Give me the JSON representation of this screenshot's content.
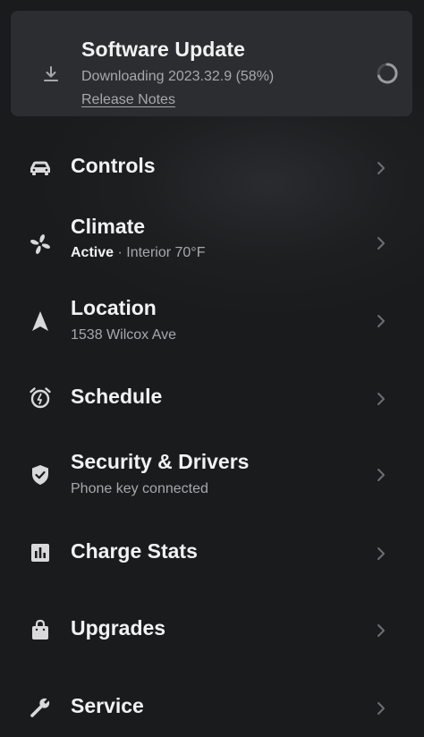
{
  "update": {
    "title": "Software Update",
    "status": "Downloading 2023.32.9 (58%)",
    "release_notes": "Release Notes",
    "progress_percent": 58,
    "icon": "download-icon"
  },
  "menu": [
    {
      "key": "controls",
      "title": "Controls",
      "subtitle": "",
      "icon": "car-icon"
    },
    {
      "key": "climate",
      "title": "Climate",
      "subtitle_strong": "Active",
      "subtitle": " · Interior 70°F",
      "icon": "fan-icon"
    },
    {
      "key": "location",
      "title": "Location",
      "subtitle": "1538 Wilcox Ave",
      "icon": "navigation-arrow-icon"
    },
    {
      "key": "schedule",
      "title": "Schedule",
      "subtitle": "",
      "icon": "alarm-clock-icon"
    },
    {
      "key": "security",
      "title": "Security & Drivers",
      "subtitle": "Phone key connected",
      "icon": "shield-icon"
    },
    {
      "key": "charge",
      "title": "Charge Stats",
      "subtitle": "",
      "icon": "bar-chart-icon"
    },
    {
      "key": "upgrades",
      "title": "Upgrades",
      "subtitle": "",
      "icon": "shopping-bag-icon"
    },
    {
      "key": "service",
      "title": "Service",
      "subtitle": "",
      "icon": "wrench-icon"
    }
  ],
  "colors": {
    "background": "#1a1b1d",
    "card": "#2c2d30",
    "text_primary": "#f2f2f3",
    "text_secondary": "#a7a8ab",
    "icon": "#d9d9db",
    "chevron": "#6e6f72"
  }
}
